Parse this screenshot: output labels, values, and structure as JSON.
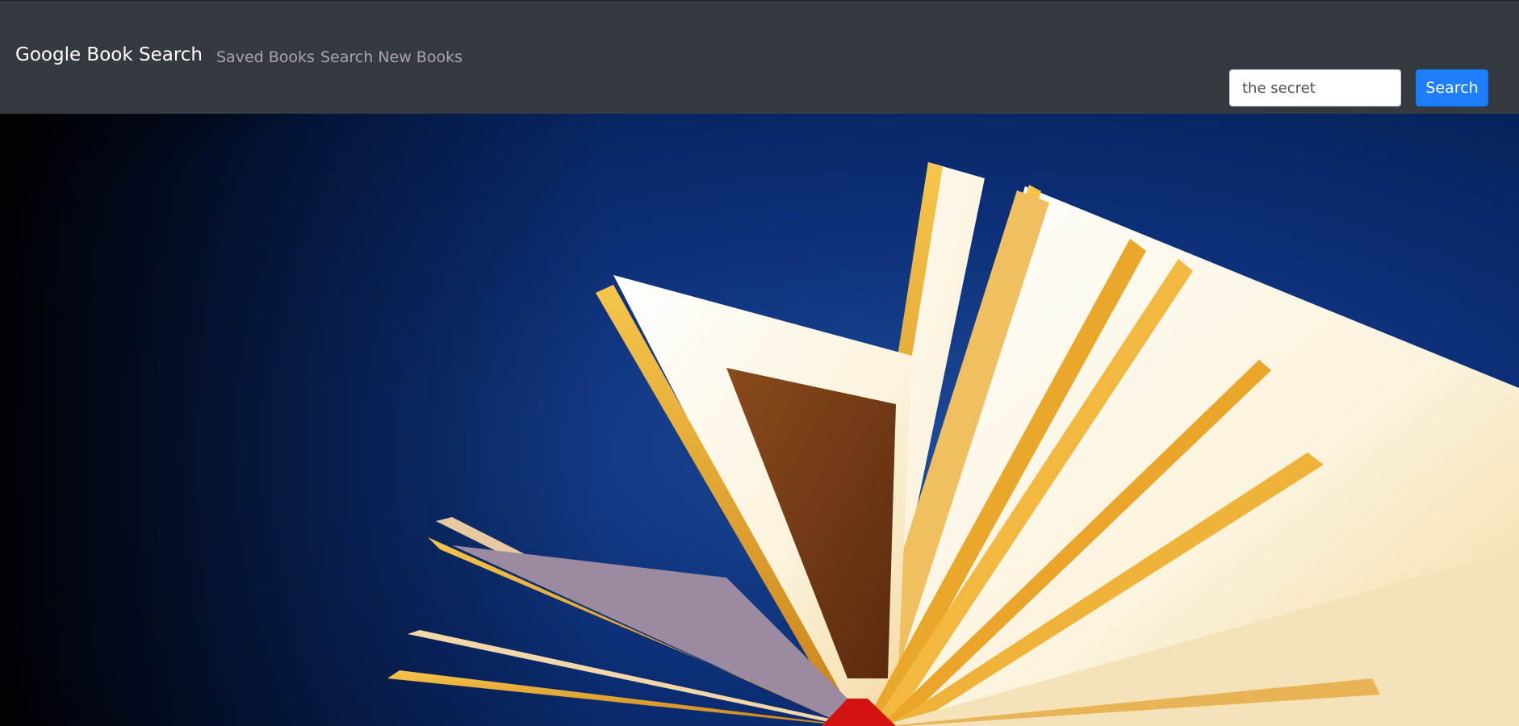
{
  "navbar": {
    "brand": "Google Book Search",
    "links": [
      {
        "label": "Saved Books"
      },
      {
        "label": "Search New Books"
      }
    ],
    "search": {
      "value": "the secret",
      "placeholder": "",
      "button_label": "Search"
    },
    "colors": {
      "background": "#343a40",
      "brand_text": "#ffffff",
      "link_text": "rgba(255,255,255,0.55)",
      "button": "#1e7efb"
    }
  },
  "hero": {
    "image": "open-book-photo",
    "colors": {
      "sky": "#0a2a6b",
      "page": "#fdf6e6",
      "page_edge": "#e8a92a"
    }
  }
}
